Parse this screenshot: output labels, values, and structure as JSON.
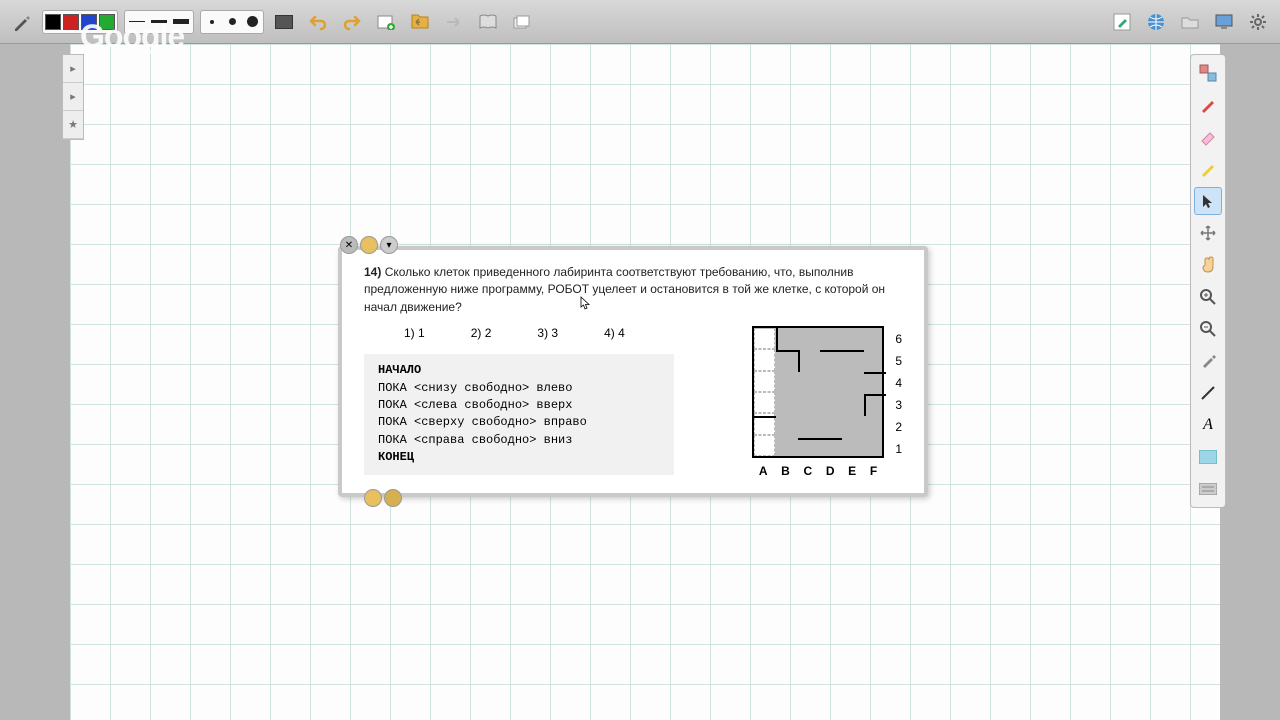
{
  "watermark": "Google",
  "toolbar": {
    "colors": [
      "#000000",
      "#cc2222",
      "#2244cc",
      "#22aa33"
    ],
    "line_widths": [
      1,
      3,
      5
    ],
    "dot_sizes": [
      3,
      6,
      10
    ]
  },
  "left_palette": [
    "▸",
    "▸",
    "★"
  ],
  "right_palette": [
    {
      "name": "fill-icon"
    },
    {
      "name": "marker-red-icon"
    },
    {
      "name": "eraser-icon"
    },
    {
      "name": "marker-yellow-icon"
    },
    {
      "name": "pointer-icon",
      "selected": true
    },
    {
      "name": "pan-icon"
    },
    {
      "name": "hand-icon"
    },
    {
      "name": "zoom-in-icon"
    },
    {
      "name": "zoom-out-icon"
    },
    {
      "name": "eyedrop-icon"
    },
    {
      "name": "line-icon"
    },
    {
      "name": "text-icon"
    },
    {
      "name": "note-icon"
    },
    {
      "name": "keyboard-icon"
    }
  ],
  "task": {
    "number": "14)",
    "question": "Сколько клеток приведенного лабиринта соответствуют требованию, что, выполнив предложенную ниже программу, РОБОТ уцелеет и остановится в той же клетке, с которой он начал движение?",
    "answers": [
      {
        "n": "1)",
        "v": "1"
      },
      {
        "n": "2)",
        "v": "2"
      },
      {
        "n": "3)",
        "v": "3"
      },
      {
        "n": "4)",
        "v": "4"
      }
    ],
    "code": [
      "НАЧАЛО",
      "ПОКА <снизу свободно> влево",
      "ПОКА <слева свободно> вверх",
      "ПОКА <сверху свободно> вправо",
      "ПОКА <справа свободно> вниз",
      "КОНЕЦ"
    ],
    "maze": {
      "cols": [
        "A",
        "B",
        "C",
        "D",
        "E",
        "F"
      ],
      "rows": [
        "6",
        "5",
        "4",
        "3",
        "2",
        "1"
      ]
    }
  }
}
